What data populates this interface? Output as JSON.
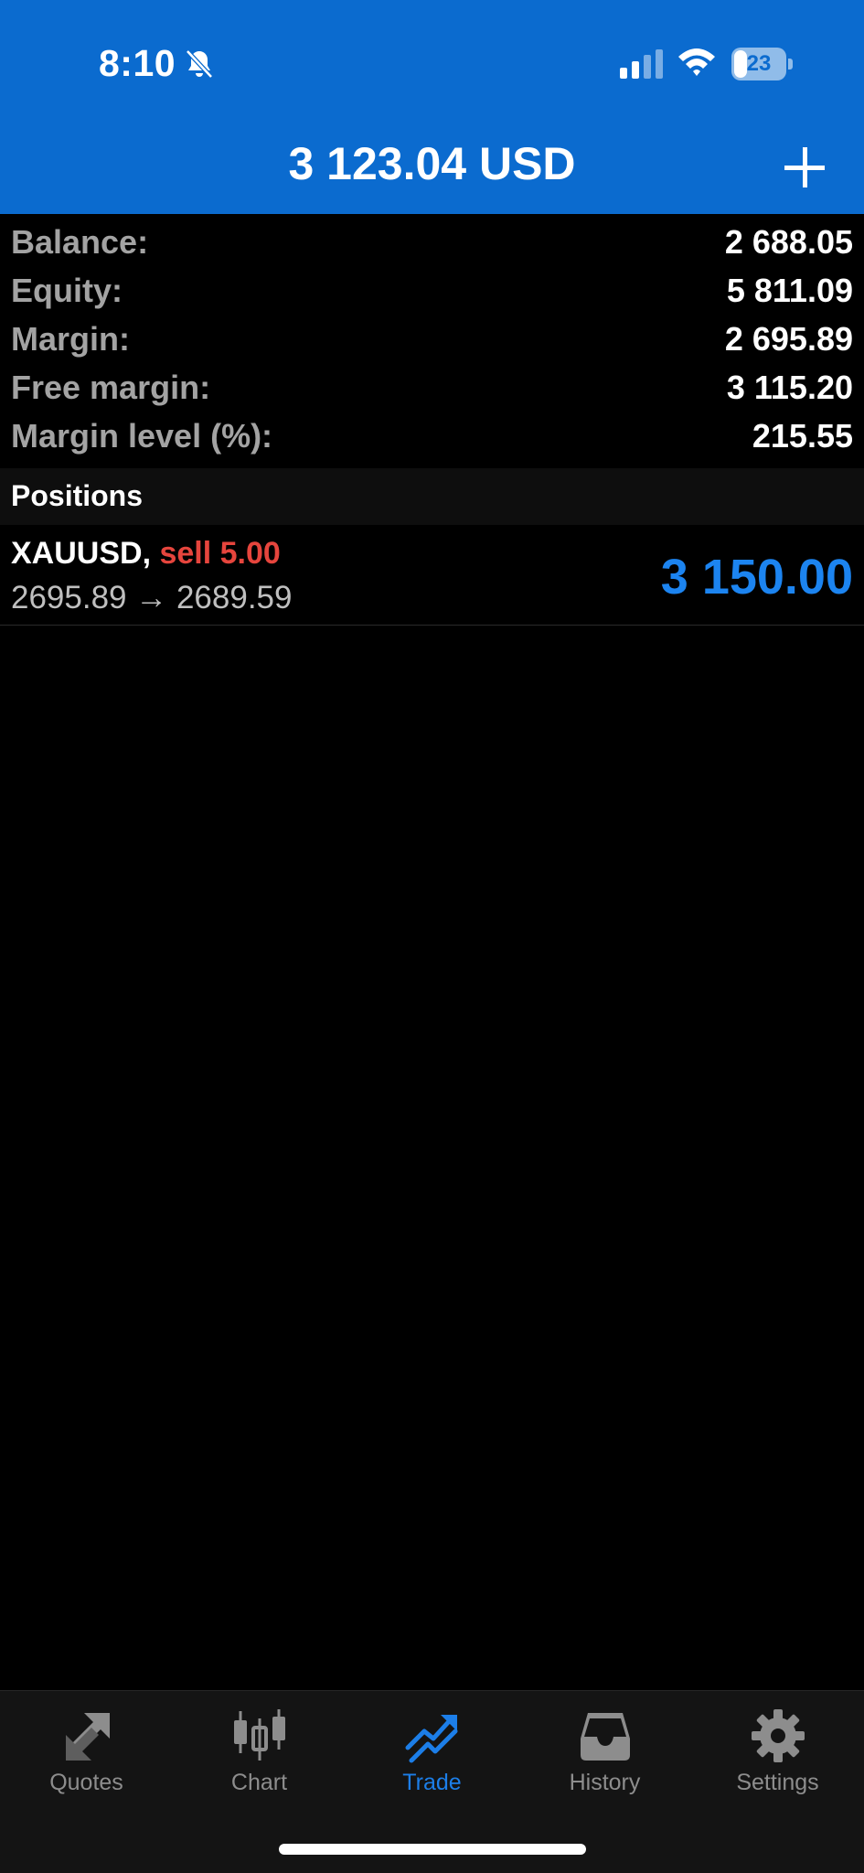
{
  "status_bar": {
    "time": "8:10",
    "battery": "23"
  },
  "header": {
    "title": "3 123.04 USD"
  },
  "summary": [
    {
      "label": "Balance:",
      "value": "2 688.05"
    },
    {
      "label": "Equity:",
      "value": "5 811.09"
    },
    {
      "label": "Margin:",
      "value": "2 695.89"
    },
    {
      "label": "Free margin:",
      "value": "3 115.20"
    },
    {
      "label": "Margin level (%):",
      "value": "215.55"
    }
  ],
  "positions": {
    "title": "Positions",
    "items": [
      {
        "symbol": "XAUUSD,",
        "side": "sell 5.00",
        "prices": "2695.89 → 2689.59",
        "profit": "3 150.00"
      }
    ]
  },
  "tabs": [
    {
      "label": "Quotes",
      "icon": "quotes-icon"
    },
    {
      "label": "Chart",
      "icon": "chart-icon"
    },
    {
      "label": "Trade",
      "icon": "trade-icon",
      "active": true
    },
    {
      "label": "History",
      "icon": "history-icon"
    },
    {
      "label": "Settings",
      "icon": "settings-icon"
    }
  ],
  "colors": {
    "header": "#0b6bcf",
    "accent": "#1c84f0",
    "sell": "#e6453d"
  }
}
